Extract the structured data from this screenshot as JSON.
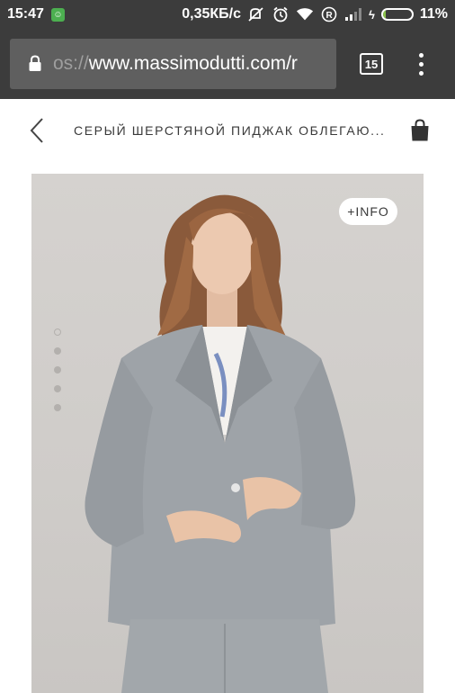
{
  "status_bar": {
    "time": "15:47",
    "speed": "0,35КБ/с",
    "battery": "11%",
    "battery_level": 0.11,
    "icons": [
      "app-notification-icon",
      "mute-icon",
      "alarm-icon",
      "wifi-icon",
      "roaming-icon",
      "signal-icon",
      "charging-icon",
      "battery-icon"
    ]
  },
  "browser": {
    "url_prefix": "os://",
    "url_main": "www.massimodutti.com/r",
    "tab_count": "15"
  },
  "product": {
    "title": "СЕРЫЙ ШЕРСТЯНОЙ ПИДЖАК ОБЛЕГАЮ...",
    "info_label": "+INFO",
    "gallery_count": 5,
    "active_image": 0
  },
  "colors": {
    "chrome": "#3c3c3c",
    "url_box": "#5f5f5f",
    "battery_fill": "#8bc34a",
    "jacket": "#9aa0a5"
  }
}
